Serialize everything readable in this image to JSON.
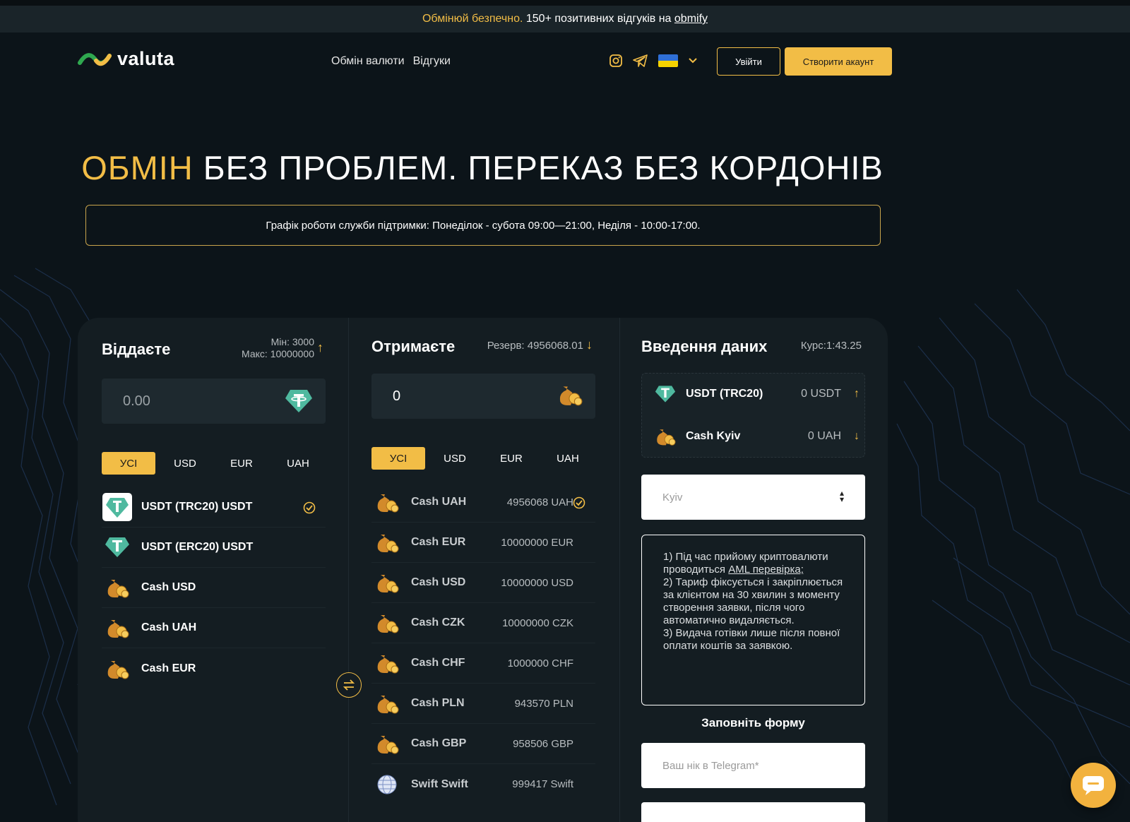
{
  "banner": {
    "text_gold": "Обмінюй безпечно.",
    "text": " 150+ позитивних відгуків на ",
    "link": "obmify"
  },
  "header": {
    "logo": "valuta",
    "nav": [
      "Обмін валюти",
      "Відгуки"
    ],
    "login": "Увійти",
    "register": "Створити акаунт"
  },
  "hero": {
    "gold": "ОБМІН",
    "rest": " БЕЗ ПРОБЛЕМ. ПЕРЕКАЗ БЕЗ КОРДОНІВ"
  },
  "notice": "Графік роботи служби підтримки: Понеділок - субота 09:00—21:00, Неділя - 10:00-17:00.",
  "give": {
    "title": "Віддаєте",
    "min": "Мін: 3000",
    "max": "Макс: 10000000",
    "amount": "0.00",
    "tabs": [
      "УСІ",
      "USD",
      "EUR",
      "UAH"
    ],
    "items": [
      "USDT (TRC20) USDT",
      "USDT (ERC20) USDT",
      "Cash USD",
      "Cash UAH",
      "Cash EUR"
    ]
  },
  "receive": {
    "title": "Отримаєте",
    "reserve": "Резерв: 4956068.01",
    "amount": "0",
    "tabs": [
      "УСІ",
      "USD",
      "EUR",
      "UAH"
    ],
    "items": [
      {
        "name": "Cash UAH",
        "value": "4956068 UAH"
      },
      {
        "name": "Cash EUR",
        "value": "10000000 EUR"
      },
      {
        "name": "Cash USD",
        "value": "10000000 USD"
      },
      {
        "name": "Cash CZK",
        "value": "10000000 CZK"
      },
      {
        "name": "Cash CHF",
        "value": "1000000 CHF"
      },
      {
        "name": "Cash PLN",
        "value": "943570 PLN"
      },
      {
        "name": "Cash GBP",
        "value": "958506 GBP"
      },
      {
        "name": "Swift Swift",
        "value": "999417 Swift"
      }
    ]
  },
  "entry": {
    "title": "Введення даних",
    "rate": "Курс:1:43.25",
    "from": {
      "name": "USDT (TRC20)",
      "value": "0 USDT"
    },
    "to": {
      "name": "Cash Kyiv",
      "value": "0 UAH"
    },
    "city": "Kyiv",
    "rule1_a": "1) Під час прийому криптовалюти проводиться ",
    "rule1_link": "AML перевірка;",
    "rule2": "2) Тариф фіксується і закріплюється за клієнтом на 30 хвилин з моменту створення заявки, після чого автоматично видаляється.",
    "rule3": "3) Видача готівки лише після повної оплати коштів за заявкою.",
    "form_title": "Заповніть форму",
    "telegram_placeholder": "Ваш нік в Telegram*"
  },
  "colors": {
    "accent": "#f2bd46",
    "background": "#0c1419",
    "panel": "#141d22"
  }
}
